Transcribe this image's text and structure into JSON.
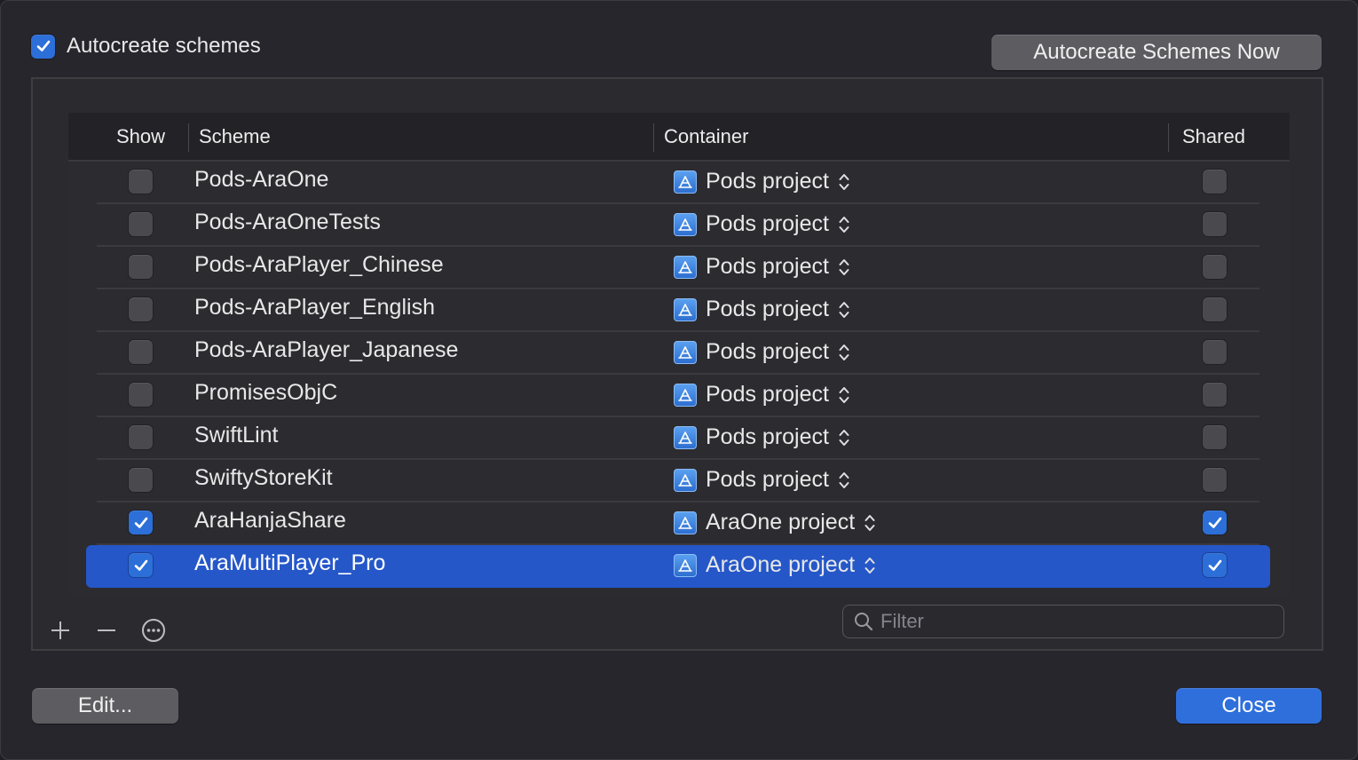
{
  "autocreate": {
    "label": "Autocreate schemes",
    "checked": true
  },
  "buttons": {
    "autocreate_now": "Autocreate Schemes Now",
    "edit": "Edit...",
    "close": "Close"
  },
  "table": {
    "columns": {
      "show": "Show",
      "scheme": "Scheme",
      "container": "Container",
      "shared": "Shared"
    },
    "rows": [
      {
        "show": false,
        "scheme": "Pods-AraOne",
        "container": "Pods project",
        "shared": false,
        "selected": false
      },
      {
        "show": false,
        "scheme": "Pods-AraOneTests",
        "container": "Pods project",
        "shared": false,
        "selected": false
      },
      {
        "show": false,
        "scheme": "Pods-AraPlayer_Chinese",
        "container": "Pods project",
        "shared": false,
        "selected": false
      },
      {
        "show": false,
        "scheme": "Pods-AraPlayer_English",
        "container": "Pods project",
        "shared": false,
        "selected": false
      },
      {
        "show": false,
        "scheme": "Pods-AraPlayer_Japanese",
        "container": "Pods project",
        "shared": false,
        "selected": false
      },
      {
        "show": false,
        "scheme": "PromisesObjC",
        "container": "Pods project",
        "shared": false,
        "selected": false
      },
      {
        "show": false,
        "scheme": "SwiftLint",
        "container": "Pods project",
        "shared": false,
        "selected": false
      },
      {
        "show": false,
        "scheme": "SwiftyStoreKit",
        "container": "Pods project",
        "shared": false,
        "selected": false
      },
      {
        "show": true,
        "scheme": "AraHanjaShare",
        "container": "AraOne project",
        "shared": true,
        "selected": false
      },
      {
        "show": true,
        "scheme": "AraMultiPlayer_Pro",
        "container": "AraOne project",
        "shared": true,
        "selected": true
      }
    ]
  },
  "toolbar": {
    "add_icon": "plus-icon",
    "remove_icon": "minus-icon",
    "more_icon": "ellipsis-circle-icon"
  },
  "filter": {
    "placeholder": "Filter",
    "value": ""
  },
  "colors": {
    "accent": "#2f6fdc",
    "selection": "#2557c9"
  }
}
